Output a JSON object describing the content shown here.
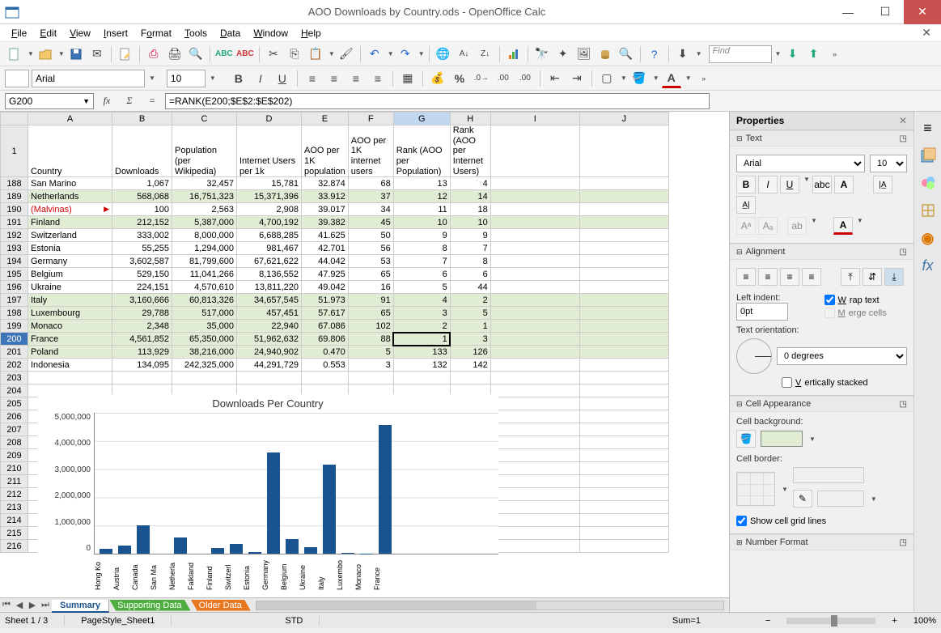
{
  "window": {
    "title": "AOO Downloads by Country.ods - OpenOffice Calc"
  },
  "menubar": [
    "File",
    "Edit",
    "View",
    "Insert",
    "Format",
    "Tools",
    "Data",
    "Window",
    "Help"
  ],
  "find_placeholder": "Find",
  "font": {
    "name": "Arial",
    "size": "10"
  },
  "cell_ref": "G200",
  "formula": "=RANK(E200;$E$2:$E$202)",
  "columns": [
    "A",
    "B",
    "C",
    "D",
    "E",
    "F",
    "G",
    "H",
    "I",
    "J"
  ],
  "header_row_num": "1",
  "headers": [
    "Country",
    "Downloads",
    "Population (per Wikipedia)",
    "Internet Users per 1k",
    "AOO per 1K population",
    "AOO per 1K internet users",
    "Rank (AOO per Population)",
    "Rank (AOO per Internet Users)"
  ],
  "rows": [
    {
      "n": "188",
      "alt": false,
      "c": [
        "San Marino",
        "1,067",
        "32,457",
        "15,781",
        "32.874",
        "68",
        "13",
        "4"
      ]
    },
    {
      "n": "189",
      "alt": true,
      "c": [
        "Netherlands",
        "568,068",
        "16,751,323",
        "15,371,396",
        "33.912",
        "37",
        "12",
        "14"
      ]
    },
    {
      "n": "190",
      "alt": false,
      "c": [
        "(Malvinas)",
        "100",
        "2,563",
        "2,908",
        "39.017",
        "34",
        "11",
        "18"
      ],
      "redA": true,
      "marker": true
    },
    {
      "n": "191",
      "alt": true,
      "c": [
        "Finland",
        "212,152",
        "5,387,000",
        "4,700,192",
        "39.382",
        "45",
        "10",
        "10"
      ]
    },
    {
      "n": "192",
      "alt": false,
      "c": [
        "Switzerland",
        "333,002",
        "8,000,000",
        "6,688,285",
        "41.625",
        "50",
        "9",
        "9"
      ]
    },
    {
      "n": "193",
      "alt": false,
      "c": [
        "Estonia",
        "55,255",
        "1,294,000",
        "981,467",
        "42.701",
        "56",
        "8",
        "7"
      ]
    },
    {
      "n": "194",
      "alt": false,
      "c": [
        "Germany",
        "3,602,587",
        "81,799,600",
        "67,621,622",
        "44.042",
        "53",
        "7",
        "8"
      ]
    },
    {
      "n": "195",
      "alt": false,
      "c": [
        "Belgium",
        "529,150",
        "11,041,266",
        "8,136,552",
        "47.925",
        "65",
        "6",
        "6"
      ]
    },
    {
      "n": "196",
      "alt": false,
      "c": [
        "Ukraine",
        "224,151",
        "4,570,610",
        "13,811,220",
        "49.042",
        "16",
        "5",
        "44"
      ]
    },
    {
      "n": "197",
      "alt": true,
      "c": [
        "Italy",
        "3,160,666",
        "60,813,326",
        "34,657,545",
        "51.973",
        "91",
        "4",
        "2"
      ]
    },
    {
      "n": "198",
      "alt": true,
      "c": [
        "Luxembourg",
        "29,788",
        "517,000",
        "457,451",
        "57.617",
        "65",
        "3",
        "5"
      ]
    },
    {
      "n": "199",
      "alt": true,
      "c": [
        "Monaco",
        "2,348",
        "35,000",
        "22,940",
        "67.086",
        "102",
        "2",
        "1"
      ]
    },
    {
      "n": "200",
      "alt": true,
      "c": [
        "France",
        "4,561,852",
        "65,350,000",
        "51,962,632",
        "69.806",
        "88",
        "1",
        "3"
      ],
      "sel": "G"
    },
    {
      "n": "201",
      "alt": true,
      "c": [
        "Poland",
        "113,929",
        "38,216,000",
        "24,940,902",
        "0.470",
        "5",
        "133",
        "126"
      ]
    },
    {
      "n": "202",
      "alt": false,
      "c": [
        "Indonesia",
        "134,095",
        "242,325,000",
        "44,291,729",
        "0.553",
        "3",
        "132",
        "142"
      ]
    }
  ],
  "empty_rows": [
    "203",
    "204",
    "205",
    "206",
    "207",
    "208",
    "209",
    "210",
    "211",
    "212",
    "213",
    "214",
    "215",
    "216"
  ],
  "chart_data": {
    "type": "bar",
    "title": "Downloads Per Country",
    "categories": [
      "Hong Ko",
      "Austria",
      "Canada",
      "San Ma",
      "Netherla",
      "Falkland",
      "Finland",
      "Switzerl",
      "Estonia",
      "Germany",
      "Belgium",
      "Ukraine",
      "Italy",
      "Luxembo",
      "Monaco",
      "France"
    ],
    "values": [
      180000,
      280000,
      1020000,
      1067,
      568068,
      100,
      212152,
      333002,
      55255,
      3602587,
      529150,
      224151,
      3160666,
      29788,
      2348,
      4561852
    ],
    "ylabel": "",
    "ylim": [
      0,
      5000000
    ],
    "y_ticks": [
      "5,000,000",
      "4,000,000",
      "3,000,000",
      "2,000,000",
      "1,000,000",
      "0"
    ]
  },
  "sheets": [
    {
      "name": "Summary",
      "style": "active"
    },
    {
      "name": "Supporting Data",
      "style": "green"
    },
    {
      "name": "Older Data",
      "style": "orange"
    }
  ],
  "statusbar": {
    "sheet": "Sheet 1 / 3",
    "style": "PageStyle_Sheet1",
    "mode": "STD",
    "sum": "Sum=1",
    "zoom": "100%"
  },
  "sidebar": {
    "title": "Properties",
    "text_section": "Text",
    "font_name": "Arial",
    "font_size": "10",
    "alignment_section": "Alignment",
    "left_indent_label": "Left indent:",
    "left_indent_value": "0pt",
    "wrap_text": "Wrap text",
    "merge_cells": "Merge cells",
    "text_orientation_label": "Text orientation:",
    "orient_value": "0 degrees",
    "vert_stacked": "Vertically stacked",
    "cell_appearance": "Cell Appearance",
    "cell_bg_label": "Cell background:",
    "cell_border_label": "Cell border:",
    "show_grid": "Show cell grid lines",
    "number_format": "Number Format"
  }
}
